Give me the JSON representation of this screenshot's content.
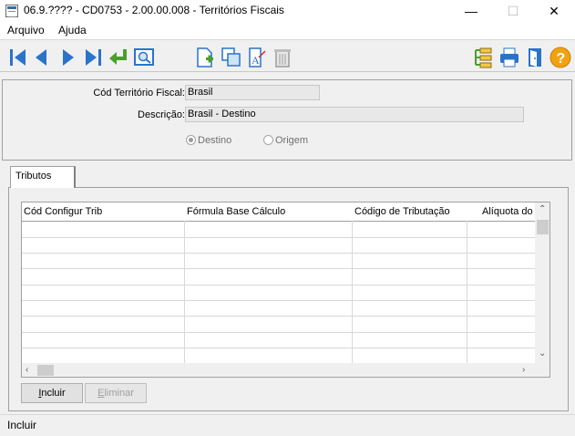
{
  "window": {
    "title": "06.9.???? - CD0753 - 2.00.00.008 - Territórios Fiscais",
    "minimize": "—",
    "maximize": "☐",
    "close": "✕"
  },
  "menu": {
    "items": [
      "Arquivo",
      "Ajuda"
    ]
  },
  "toolbar": {
    "left_icons": [
      "first-record-icon",
      "previous-record-icon",
      "next-record-icon",
      "last-record-icon",
      "goto-icon",
      "search-icon"
    ],
    "middle_icons": [
      "new-record-icon",
      "copy-record-icon",
      "edit-record-icon",
      "delete-record-icon"
    ],
    "right_icons": [
      "tree-icon",
      "print-icon",
      "exit-icon",
      "help-icon"
    ]
  },
  "form": {
    "cod_label": "Cód Território Fiscal:",
    "cod_value": "Brasil",
    "desc_label": "Descrição:",
    "desc_value": "Brasil - Destino",
    "radio_destino": "Destino",
    "radio_origem": "Origem",
    "selected": "Destino"
  },
  "tab": {
    "label": "Tributos"
  },
  "grid": {
    "columns": [
      "Cód Configur Trib",
      "Fórmula Base Cálculo",
      "Código de Tributação",
      "Alíquota do"
    ],
    "rows": []
  },
  "buttons": {
    "incluir_u": "I",
    "incluir_rest": "ncluir",
    "eliminar_u": "E",
    "eliminar_rest": "liminar"
  },
  "status": {
    "text": "Incluir"
  },
  "colors": {
    "nav_blue": "#2a73c9",
    "accent_green": "#48a02a",
    "help_orange": "#f2a20f"
  }
}
